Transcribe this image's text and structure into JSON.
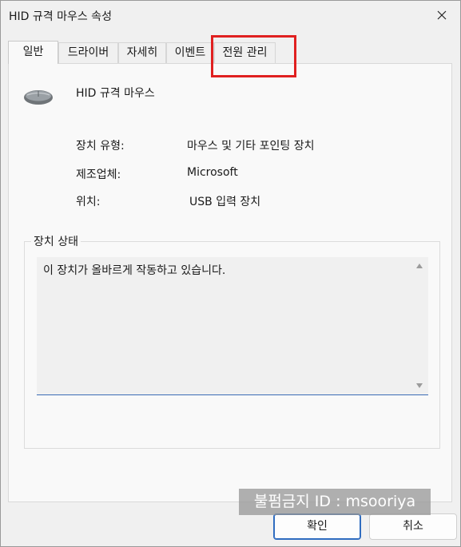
{
  "window": {
    "title": "HID 규격 마우스 속성"
  },
  "tabs": [
    {
      "label": "일반",
      "active": true
    },
    {
      "label": "드라이버",
      "active": false
    },
    {
      "label": "자세히",
      "active": false
    },
    {
      "label": "이벤트",
      "active": false
    },
    {
      "label": "전원 관리",
      "active": false
    }
  ],
  "device": {
    "name": "HID 규격 마우스",
    "icon": "mouse-icon",
    "properties": [
      {
        "label": "장치 유형:",
        "value": "마우스 및 기타 포인팅 장치"
      },
      {
        "label": "제조업체:",
        "value": "Microsoft"
      },
      {
        "label": "위치:",
        "value": "USB 입력 장치"
      }
    ]
  },
  "status": {
    "group_title": "장치 상태",
    "text": "이 장치가 올바르게 작동하고 있습니다."
  },
  "watermark": "불펌금지 ID : msooriya",
  "buttons": {
    "ok": "확인",
    "cancel": "취소"
  },
  "colors": {
    "highlight": "#e02020",
    "focus": "#2f6cc0"
  }
}
